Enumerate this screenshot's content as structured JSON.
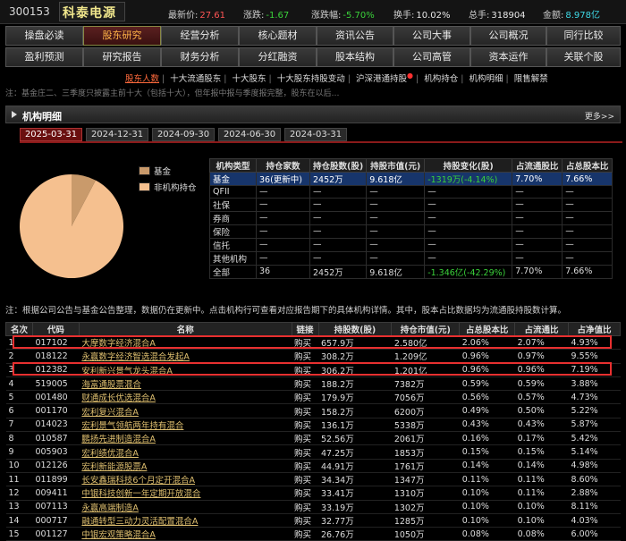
{
  "header": {
    "code": "300153",
    "name": "科泰电源",
    "latest_label": "最新价:",
    "latest_value": "27.61",
    "change_label": "涨跌:",
    "change_value": "-1.67",
    "change_pct_label": "涨跌幅:",
    "change_pct_value": "-5.70%",
    "turnover_label": "换手:",
    "turnover_value": "10.02%",
    "volume_label": "总手:",
    "volume_value": "318904",
    "amount_label": "金额:",
    "amount_value": "8.978亿"
  },
  "tabs_row1": [
    "操盘必读",
    "股东研究",
    "经营分析",
    "核心题材",
    "资讯公告",
    "公司大事",
    "公司概况",
    "同行比较"
  ],
  "tabs_row2": [
    "盈利预测",
    "研究报告",
    "财务分析",
    "分红融资",
    "股本结构",
    "公司高管",
    "资本运作",
    "关联个股"
  ],
  "subnav": [
    "股东人数",
    "十大流通股东",
    "十大股东",
    "十大股东持股变动",
    "沪深港通持股",
    "机构持仓",
    "机构明细",
    "限售解禁"
  ],
  "top_notice": "注：基金庄二、三季度只披露主前十大（包括十大），但年报中报与季度报完整，股东在以后…",
  "section": {
    "title": "机构明细",
    "more": "更多>>"
  },
  "date_tabs": [
    "2025-03-31",
    "2024-12-31",
    "2024-09-30",
    "2024-06-30",
    "2024-03-31"
  ],
  "pie": {
    "legend": [
      {
        "label": "基金",
        "color": "#c99a6b"
      },
      {
        "label": "非机构持仓",
        "color": "#f5c08f"
      }
    ]
  },
  "chart_data": {
    "type": "pie",
    "categories": [
      "基金",
      "非机构持仓"
    ],
    "values": [
      7.7,
      92.3
    ],
    "colors": [
      "#c99a6b",
      "#f5c08f"
    ]
  },
  "inst_table": {
    "headers": [
      "机构类型",
      "持仓家数",
      "持仓股数(股)",
      "持股市值(元)",
      "持股变化(股)",
      "占流通股比",
      "占总股本比"
    ],
    "rows": [
      [
        "基金",
        "36(更新中)",
        "2452万",
        "9.618亿",
        "-1319万(-4.14%)",
        "7.70%",
        "7.66%"
      ],
      [
        "QFII",
        "—",
        "—",
        "—",
        "—",
        "—",
        "—"
      ],
      [
        "社保",
        "—",
        "—",
        "—",
        "—",
        "—",
        "—"
      ],
      [
        "券商",
        "—",
        "—",
        "—",
        "—",
        "—",
        "—"
      ],
      [
        "保险",
        "—",
        "—",
        "—",
        "—",
        "—",
        "—"
      ],
      [
        "信托",
        "—",
        "—",
        "—",
        "—",
        "—",
        "—"
      ],
      [
        "其他机构",
        "—",
        "—",
        "—",
        "—",
        "—",
        "—"
      ],
      [
        "全部",
        "36",
        "2452万",
        "9.618亿",
        "-1.346亿(-42.29%)",
        "7.70%",
        "7.66%"
      ]
    ]
  },
  "mid_notice": "注：根据公司公告与基金公告整理，数据仍在更新中。点击机构行可查看对应报告期下的具体机构详情。其中，股本占比数据均为流通股持股数计算。",
  "fund_table": {
    "headers": [
      "名次",
      "代码",
      "名称",
      "链接",
      "持股数(股)",
      "持仓市值(元)",
      "占总股本比",
      "占流通比",
      "占净值比"
    ],
    "rows": [
      [
        "1",
        "017102",
        "大摩数字经济混合A",
        "购买",
        "657.9万",
        "2.580亿",
        "2.06%",
        "2.07%",
        "4.93%"
      ],
      [
        "2",
        "018122",
        "永赢数字经济智选混合发起A",
        "购买",
        "308.2万",
        "1.209亿",
        "0.96%",
        "0.97%",
        "9.55%"
      ],
      [
        "3",
        "012382",
        "安利新兴景气龙头混合A",
        "购买",
        "306.2万",
        "1.201亿",
        "0.96%",
        "0.96%",
        "7.19%"
      ],
      [
        "4",
        "519005",
        "海富通股票混合",
        "购买",
        "188.2万",
        "7382万",
        "0.59%",
        "0.59%",
        "3.88%"
      ],
      [
        "5",
        "001480",
        "财通成长优选混合A",
        "购买",
        "179.9万",
        "7056万",
        "0.56%",
        "0.57%",
        "4.73%"
      ],
      [
        "6",
        "001170",
        "宏利复兴混合A",
        "购买",
        "158.2万",
        "6200万",
        "0.49%",
        "0.50%",
        "5.22%"
      ],
      [
        "7",
        "014023",
        "宏利景气领航两年持有混合",
        "购买",
        "136.1万",
        "5338万",
        "0.43%",
        "0.43%",
        "5.87%"
      ],
      [
        "8",
        "010587",
        "鹏扬先进制造混合A",
        "购买",
        "52.56万",
        "2061万",
        "0.16%",
        "0.17%",
        "5.42%"
      ],
      [
        "9",
        "005903",
        "宏利绩优混合A",
        "购买",
        "47.25万",
        "1853万",
        "0.15%",
        "0.15%",
        "5.14%"
      ],
      [
        "10",
        "012126",
        "宏利新能源股票A",
        "购买",
        "44.91万",
        "1761万",
        "0.14%",
        "0.14%",
        "4.98%"
      ],
      [
        "11",
        "011899",
        "长安鑫瑞科技6个月定开混合A",
        "购买",
        "34.34万",
        "1347万",
        "0.11%",
        "0.11%",
        "8.60%"
      ],
      [
        "12",
        "009411",
        "中银科技创新一年定期开放混合",
        "购买",
        "33.41万",
        "1310万",
        "0.10%",
        "0.11%",
        "2.88%"
      ],
      [
        "13",
        "007113",
        "永赢高端制造A",
        "购买",
        "33.19万",
        "1302万",
        "0.10%",
        "0.10%",
        "8.11%"
      ],
      [
        "14",
        "000717",
        "融通转型三动力灵活配置混合A",
        "购买",
        "32.77万",
        "1285万",
        "0.10%",
        "0.10%",
        "4.03%"
      ],
      [
        "15",
        "001127",
        "中银宏观策略混合A",
        "购买",
        "26.76万",
        "1050万",
        "0.08%",
        "0.08%",
        "6.00%"
      ]
    ]
  }
}
